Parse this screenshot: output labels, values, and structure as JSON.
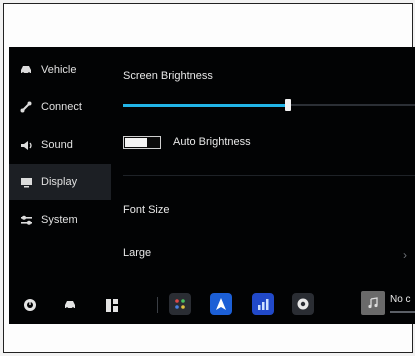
{
  "sidebar": {
    "items": [
      {
        "label": "Vehicle",
        "icon": "car-icon"
      },
      {
        "label": "Connect",
        "icon": "link-icon"
      },
      {
        "label": "Sound",
        "icon": "speaker-icon"
      },
      {
        "label": "Display",
        "icon": "monitor-icon",
        "active": true
      },
      {
        "label": "System",
        "icon": "sliders-icon"
      }
    ]
  },
  "main": {
    "brightness_label": "Screen Brightness",
    "brightness_value": 0.55,
    "auto_brightness_label": "Auto Brightness",
    "auto_brightness_on": false,
    "font_size_label": "Font Size",
    "font_size_value": "Large"
  },
  "bottombar": {
    "music_text": "No c",
    "icons": [
      "speedometer-icon",
      "car-icon",
      "grid-icon",
      "apps-icon",
      "navigation-icon",
      "chart-icon",
      "settings-icon",
      "music-icon"
    ]
  },
  "colors": {
    "accent": "#22b5e8",
    "screen_bg": "#020304",
    "active_bg": "#1c1f24",
    "nav_tile": "#1c5fd6",
    "chart_tile": "#2149c9"
  }
}
